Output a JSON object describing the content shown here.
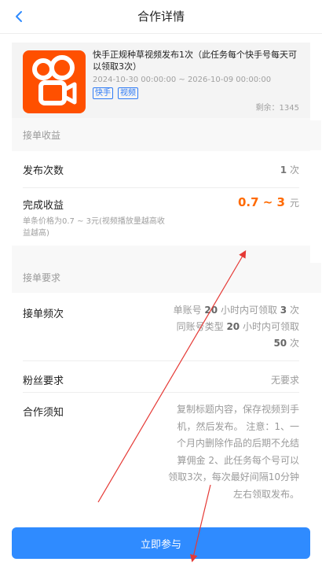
{
  "header": {
    "title": "合作详情"
  },
  "task": {
    "title": "快手正规种草视频发布1次（此任务每个快手号每天可以领取3次）",
    "date_range": "2024-10-30 00:00:00 ~ 2026-10-09 00:00:00",
    "tags": [
      "快手",
      "视频"
    ],
    "remaining": "剩余：1345",
    "logo_color": "#ff5000"
  },
  "income_section": {
    "header": "接单收益",
    "publish_count_label": "发布次数",
    "publish_count_value": "1",
    "publish_count_unit": "次",
    "income_label": "完成收益",
    "income_range": "0.7 ~ 3",
    "income_unit": "元",
    "income_note": "单条价格为0.7 ~ 3元(视频播放量越高收益越高)"
  },
  "requirements_section": {
    "header": "接单要求",
    "frequency_label": "接单频次",
    "frequency_line1_pre": "单账号",
    "frequency_line1_num": "20",
    "frequency_line1_mid": "小时内可领取",
    "frequency_line1_count": "3",
    "frequency_line1_unit": "次",
    "frequency_line2_pre": "同账号类型",
    "frequency_line2_num": "20",
    "frequency_line2_mid": "小时内可领取",
    "frequency_line3_count": "50",
    "frequency_line3_unit": "次",
    "fans_label": "粉丝要求",
    "fans_value": "无要求",
    "notice_label": "合作须知",
    "notice_lines": [
      "复制标题内容，保存视频到手",
      "机，然后发布。 注意：1、一",
      "个月内删除作品的后期不允结",
      "算佣金 2、此任务每个号可以",
      "领取3次，每次最好间隔10分钟",
      "左右领取发布。"
    ]
  },
  "footer": {
    "join_label": "立即参与"
  },
  "colors": {
    "accent": "#2f8bff",
    "income": "#ff6a00",
    "annotation_arrow": "#e53935"
  }
}
